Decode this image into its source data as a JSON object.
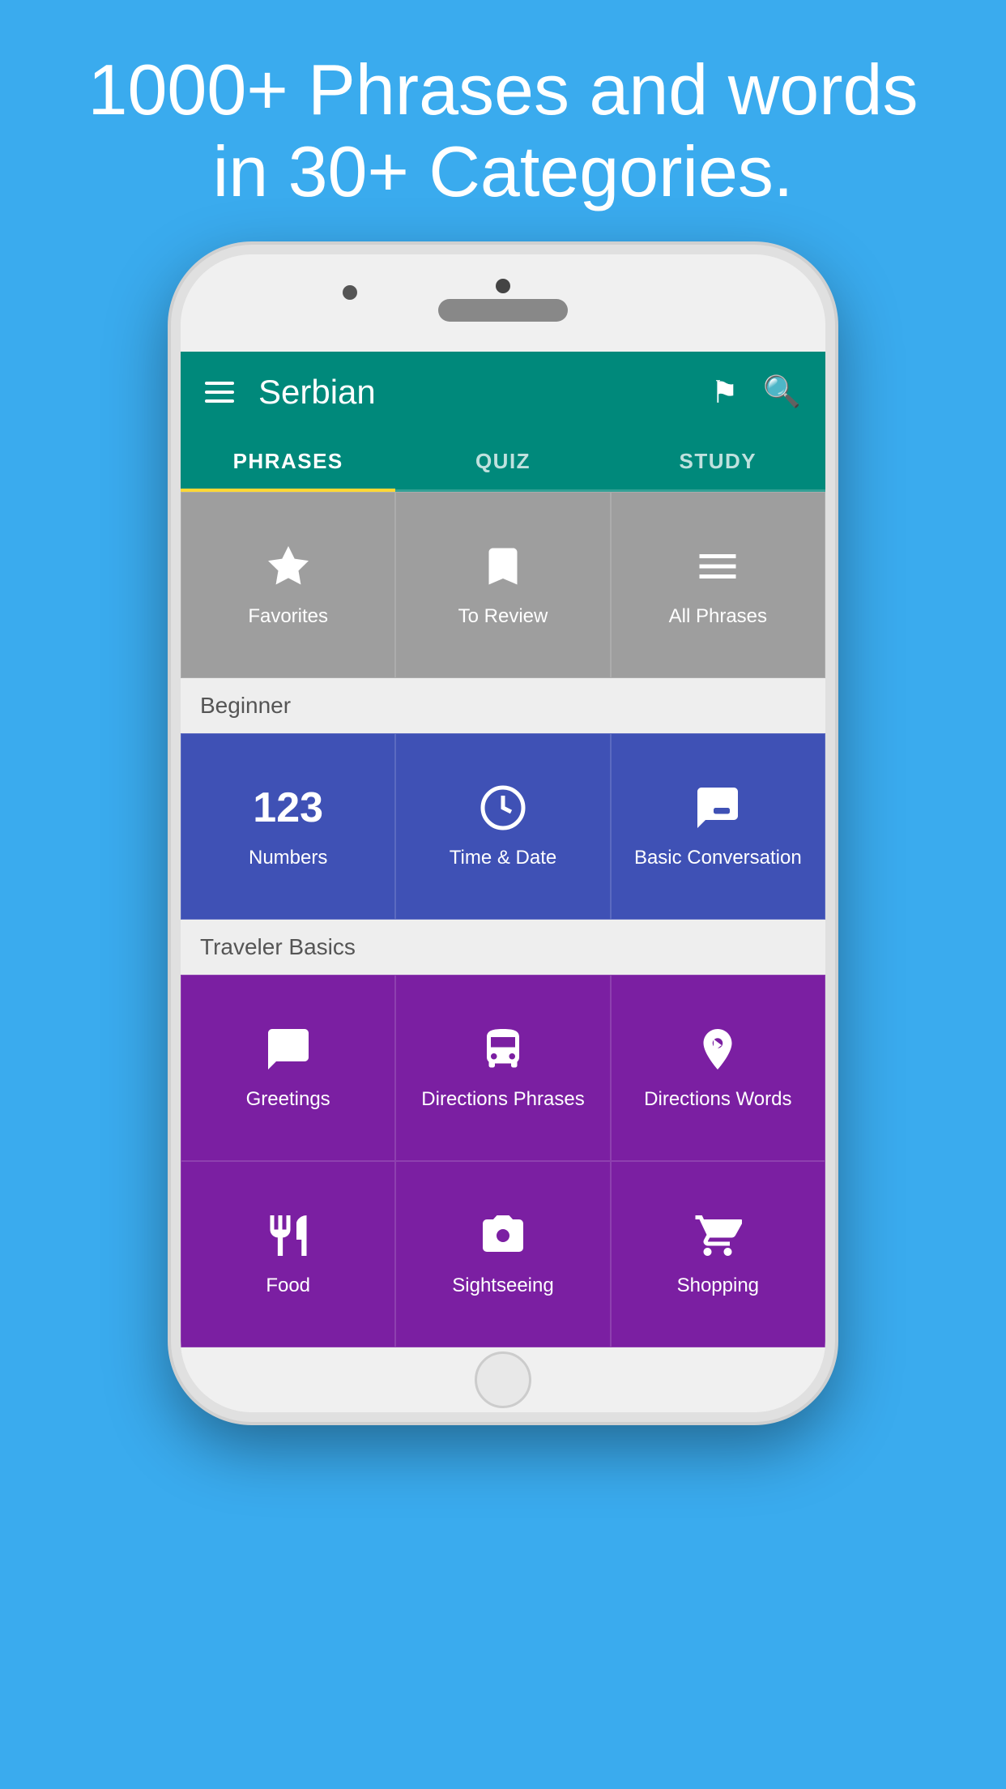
{
  "hero": {
    "line1": "1000+ Phrases and words",
    "line2": "in 30+ Categories."
  },
  "app": {
    "title": "Serbian",
    "tabs": [
      {
        "label": "PHRASES",
        "active": true
      },
      {
        "label": "QUIZ",
        "active": false
      },
      {
        "label": "STUDY",
        "active": false
      }
    ],
    "sections": [
      {
        "label": "",
        "tiles": [
          {
            "id": "favorites",
            "label": "Favorites",
            "icon": "star",
            "color": "gray"
          },
          {
            "id": "to-review",
            "label": "To Review",
            "icon": "bookmark",
            "color": "gray"
          },
          {
            "id": "all-phrases",
            "label": "All Phrases",
            "icon": "lines",
            "color": "gray"
          }
        ]
      },
      {
        "label": "Beginner",
        "tiles": [
          {
            "id": "numbers",
            "label": "Numbers",
            "icon": "123",
            "color": "blue"
          },
          {
            "id": "time-date",
            "label": "Time & Date",
            "icon": "clock",
            "color": "blue"
          },
          {
            "id": "basic-conversation",
            "label": "Basic Conversation",
            "icon": "chat",
            "color": "blue"
          }
        ]
      },
      {
        "label": "Traveler Basics",
        "tiles": [
          {
            "id": "greetings",
            "label": "Greetings",
            "icon": "speech",
            "color": "purple"
          },
          {
            "id": "directions-phrases",
            "label": "Directions Phrases",
            "icon": "bus",
            "color": "purple"
          },
          {
            "id": "directions-words",
            "label": "Directions Words",
            "icon": "direction",
            "color": "purple"
          }
        ]
      },
      {
        "label": "",
        "tiles": [
          {
            "id": "food",
            "label": "Food",
            "icon": "fork",
            "color": "purple"
          },
          {
            "id": "sightseeing",
            "label": "Sightseeing",
            "icon": "camera",
            "color": "purple"
          },
          {
            "id": "shopping",
            "label": "Shopping",
            "icon": "cart",
            "color": "purple"
          }
        ]
      }
    ]
  }
}
